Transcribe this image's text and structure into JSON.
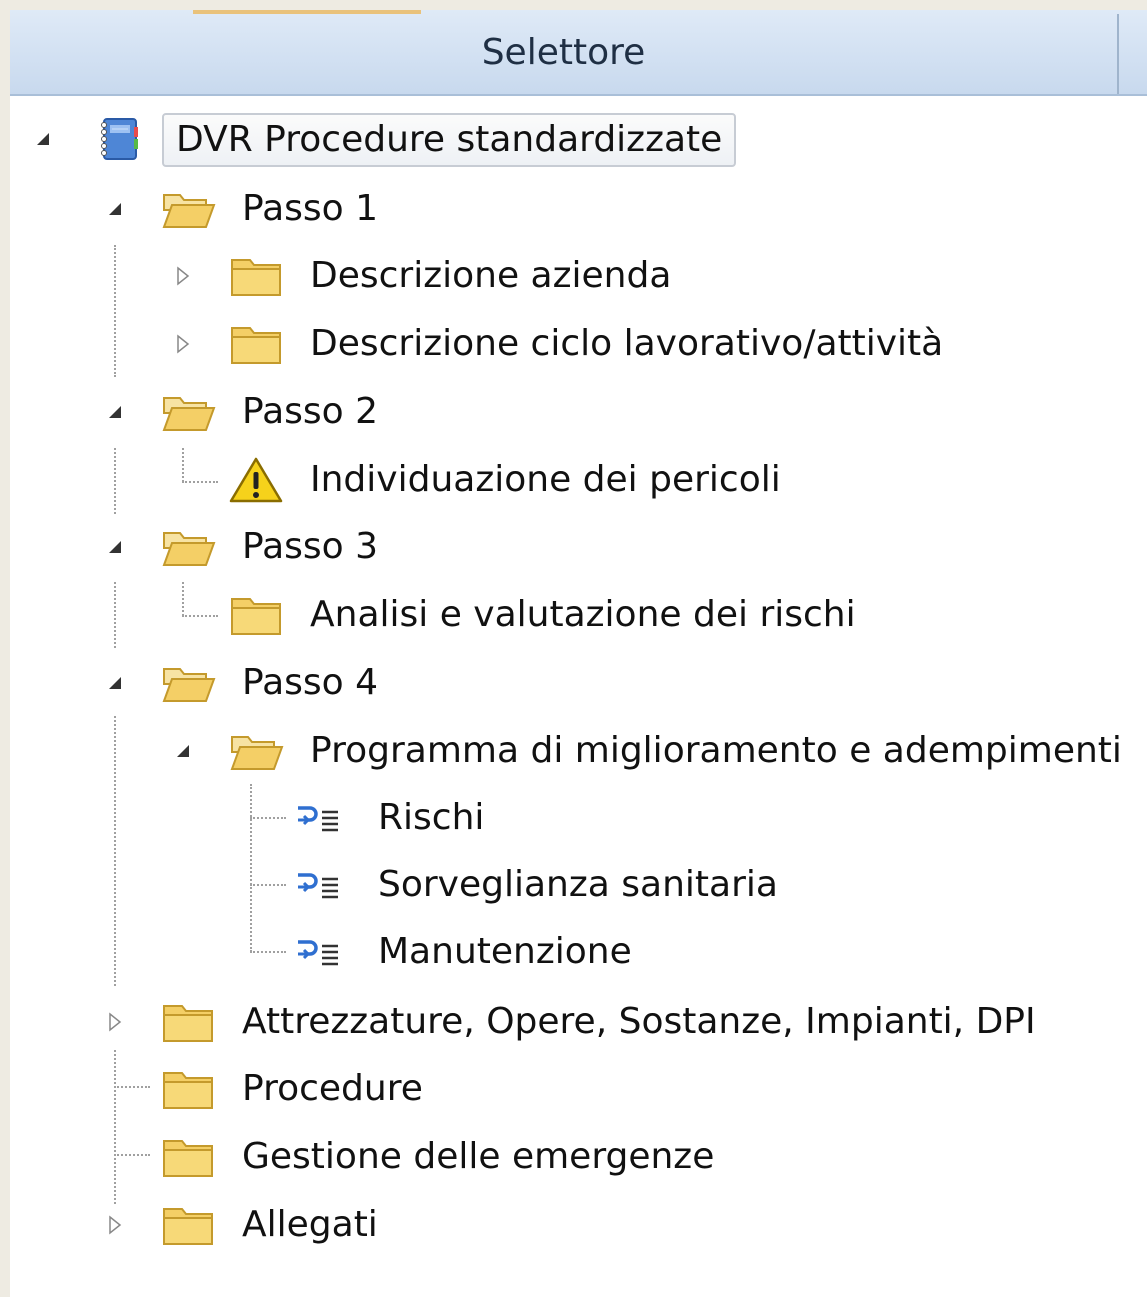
{
  "header": {
    "title": "Selettore"
  },
  "tree": {
    "root": {
      "label": "DVR Procedure standardizzate",
      "icon": "notebook-icon",
      "expanded": true
    },
    "passo1": {
      "label": "Passo 1",
      "expanded": true,
      "children": [
        {
          "label": "Descrizione azienda",
          "collapsed": true
        },
        {
          "label": "Descrizione ciclo lavorativo/attività",
          "collapsed": true
        }
      ]
    },
    "passo2": {
      "label": "Passo 2",
      "expanded": true,
      "children": [
        {
          "label": "Individuazione dei pericoli",
          "icon": "warning-icon"
        }
      ]
    },
    "passo3": {
      "label": "Passo 3",
      "expanded": true,
      "children": [
        {
          "label": "Analisi e valutazione dei rischi"
        }
      ]
    },
    "passo4": {
      "label": "Passo 4",
      "expanded": true,
      "children": [
        {
          "label": "Programma di miglioramento e adempimenti",
          "expanded": true,
          "children": [
            {
              "label": "Rischi",
              "icon": "list-link-icon"
            },
            {
              "label": "Sorveglianza sanitaria",
              "icon": "list-link-icon"
            },
            {
              "label": "Manutenzione",
              "icon": "list-link-icon"
            }
          ]
        }
      ]
    },
    "attrezzature": {
      "label": "Attrezzature, Opere, Sostanze, Impianti, DPI",
      "collapsed": true
    },
    "procedure": {
      "label": "Procedure"
    },
    "emergenze": {
      "label": "Gestione delle emergenze"
    },
    "allegati": {
      "label": "Allegati",
      "collapsed": true
    }
  },
  "colors": {
    "folder": "#f2c94c",
    "header": "#d3e1f2",
    "warning": "#f6d21b"
  }
}
